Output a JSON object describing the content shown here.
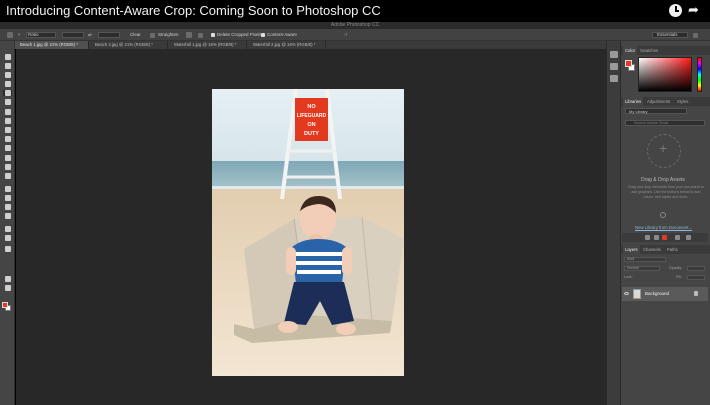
{
  "video": {
    "title": "Introducing Content-Aware Crop: Coming Soon to Photoshop CC",
    "icons": [
      "clock-icon",
      "share-icon"
    ]
  },
  "app": {
    "name": "Adobe Photoshop CC"
  },
  "options_bar": {
    "ratio_select": "Ratio",
    "clear_label": "Clear",
    "straighten_label": "Straighten",
    "delete_cropped_label": "Delete Cropped Pixels",
    "content_aware_label": "Content-Aware",
    "workspace_label": "Essentials"
  },
  "tabs": [
    {
      "label": "Beach 1.jpg @ 21% (RGB/8) *"
    },
    {
      "label": "Beach 2.jpg @ 21% (RGB/8) *"
    },
    {
      "label": "Waterfall 1.jpg @ 16% (RGB/8) *"
    },
    {
      "label": "Waterfall 2.jpg @ 16% (RGB/8) *"
    }
  ],
  "photo": {
    "sign_line1": "NO",
    "sign_line2": "LIFEGUARD",
    "sign_line3": "ON",
    "sign_line4": "DUTY"
  },
  "panels": {
    "color_tabs": [
      "Color",
      "Swatches"
    ],
    "library_tabs": [
      "Libraries",
      "Adjustments",
      "Styles"
    ],
    "library_select": "My Library",
    "search_placeholder": "Search Adobe Stock",
    "drag_title": "Drag & Drop Assets",
    "drag_text": "Drag and drop elements from your document to add graphics. Use the buttons below to add colors, text styles and more.",
    "library_link": "New Library from Document...",
    "layers_tabs": [
      "Layers",
      "Channels",
      "Paths"
    ],
    "layer_kind": "Kind",
    "layer_mode": "Normal",
    "opacity_label": "Opacity:",
    "fill_label": "Fill:",
    "lock_label": "Lock:",
    "layer_name": "Background"
  },
  "colors": {
    "foreground": "#e03a2a",
    "background": "#ffffff"
  }
}
